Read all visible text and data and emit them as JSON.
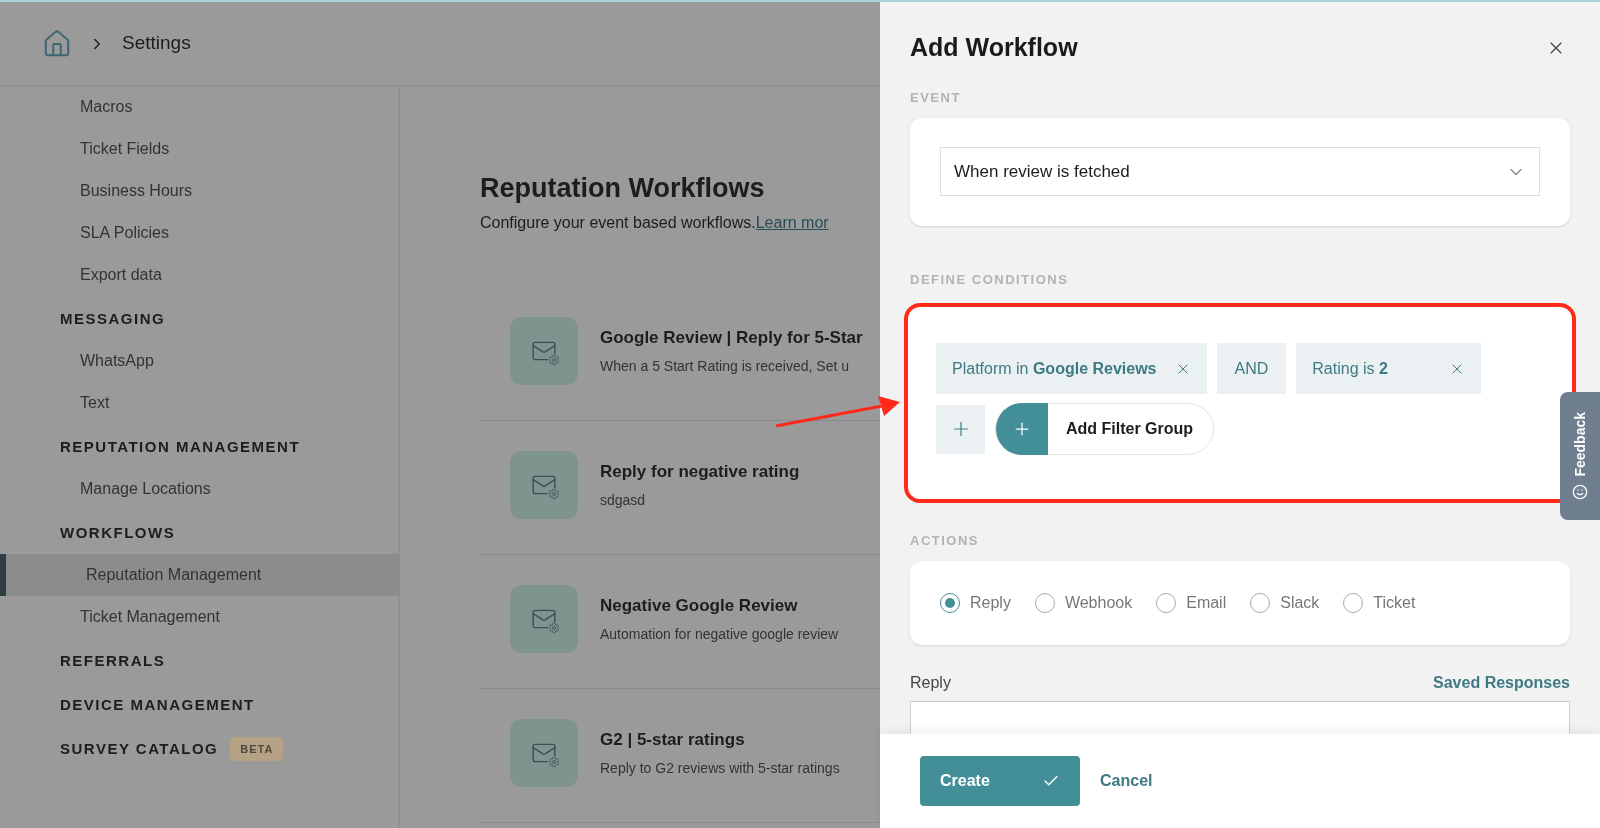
{
  "breadcrumb": {
    "current": "Settings"
  },
  "sidebar": {
    "sections": [
      {
        "items": [
          {
            "label": "Macros",
            "selected": false
          },
          {
            "label": "Ticket Fields",
            "selected": false
          },
          {
            "label": "Business Hours",
            "selected": false
          },
          {
            "label": "SLA Policies",
            "selected": false
          },
          {
            "label": "Export data",
            "selected": false
          }
        ]
      },
      {
        "heading": "MESSAGING",
        "items": [
          {
            "label": "WhatsApp",
            "selected": false
          },
          {
            "label": "Text",
            "selected": false
          }
        ]
      },
      {
        "heading": "REPUTATION MANAGEMENT",
        "items": [
          {
            "label": "Manage Locations",
            "selected": false
          }
        ]
      },
      {
        "heading": "WORKFLOWS",
        "items": [
          {
            "label": "Reputation Management",
            "selected": true
          },
          {
            "label": "Ticket Management",
            "selected": false
          }
        ]
      },
      {
        "heading": "REFERRALS"
      },
      {
        "heading": "DEVICE MANAGEMENT"
      },
      {
        "heading": "SURVEY CATALOG",
        "badge": "BETA"
      }
    ]
  },
  "page": {
    "title": "Reputation Workflows",
    "subtitle": "Configure your event based workflows.",
    "link": "Learn mor",
    "workflows": [
      {
        "title": "Google Review | Reply for 5-Star",
        "description": "When a 5 Start Rating is received, Set u"
      },
      {
        "title": "Reply for negative rating",
        "description": "sdgasd"
      },
      {
        "title": "Negative Google Review",
        "description": "Automation for negative google review"
      },
      {
        "title": "G2 | 5-star ratings",
        "description": "Reply to G2 reviews with 5-star ratings"
      }
    ]
  },
  "drawer": {
    "title": "Add Workflow",
    "event": {
      "label": "EVENT",
      "value": "When review is fetched"
    },
    "conditions": {
      "label": "DEFINE CONDITIONS",
      "highlighted": true,
      "filters": [
        {
          "kind": "filter",
          "text": "Platform in **Google Reviews**"
        },
        {
          "kind": "operator",
          "text": "AND"
        },
        {
          "kind": "filter",
          "text": "Rating is **2**"
        }
      ],
      "add_filter_group": "Add Filter Group"
    },
    "actions": {
      "label": "ACTIONS",
      "options": [
        {
          "label": "Reply",
          "selected": true
        },
        {
          "label": "Webhook",
          "selected": false
        },
        {
          "label": "Email",
          "selected": false
        },
        {
          "label": "Slack",
          "selected": false
        },
        {
          "label": "Ticket",
          "selected": false
        }
      ]
    },
    "reply": {
      "label": "Reply",
      "saved_responses": "Saved Responses"
    },
    "create": "Create",
    "cancel": "Cancel"
  },
  "feedback_tab": "Feedback"
}
